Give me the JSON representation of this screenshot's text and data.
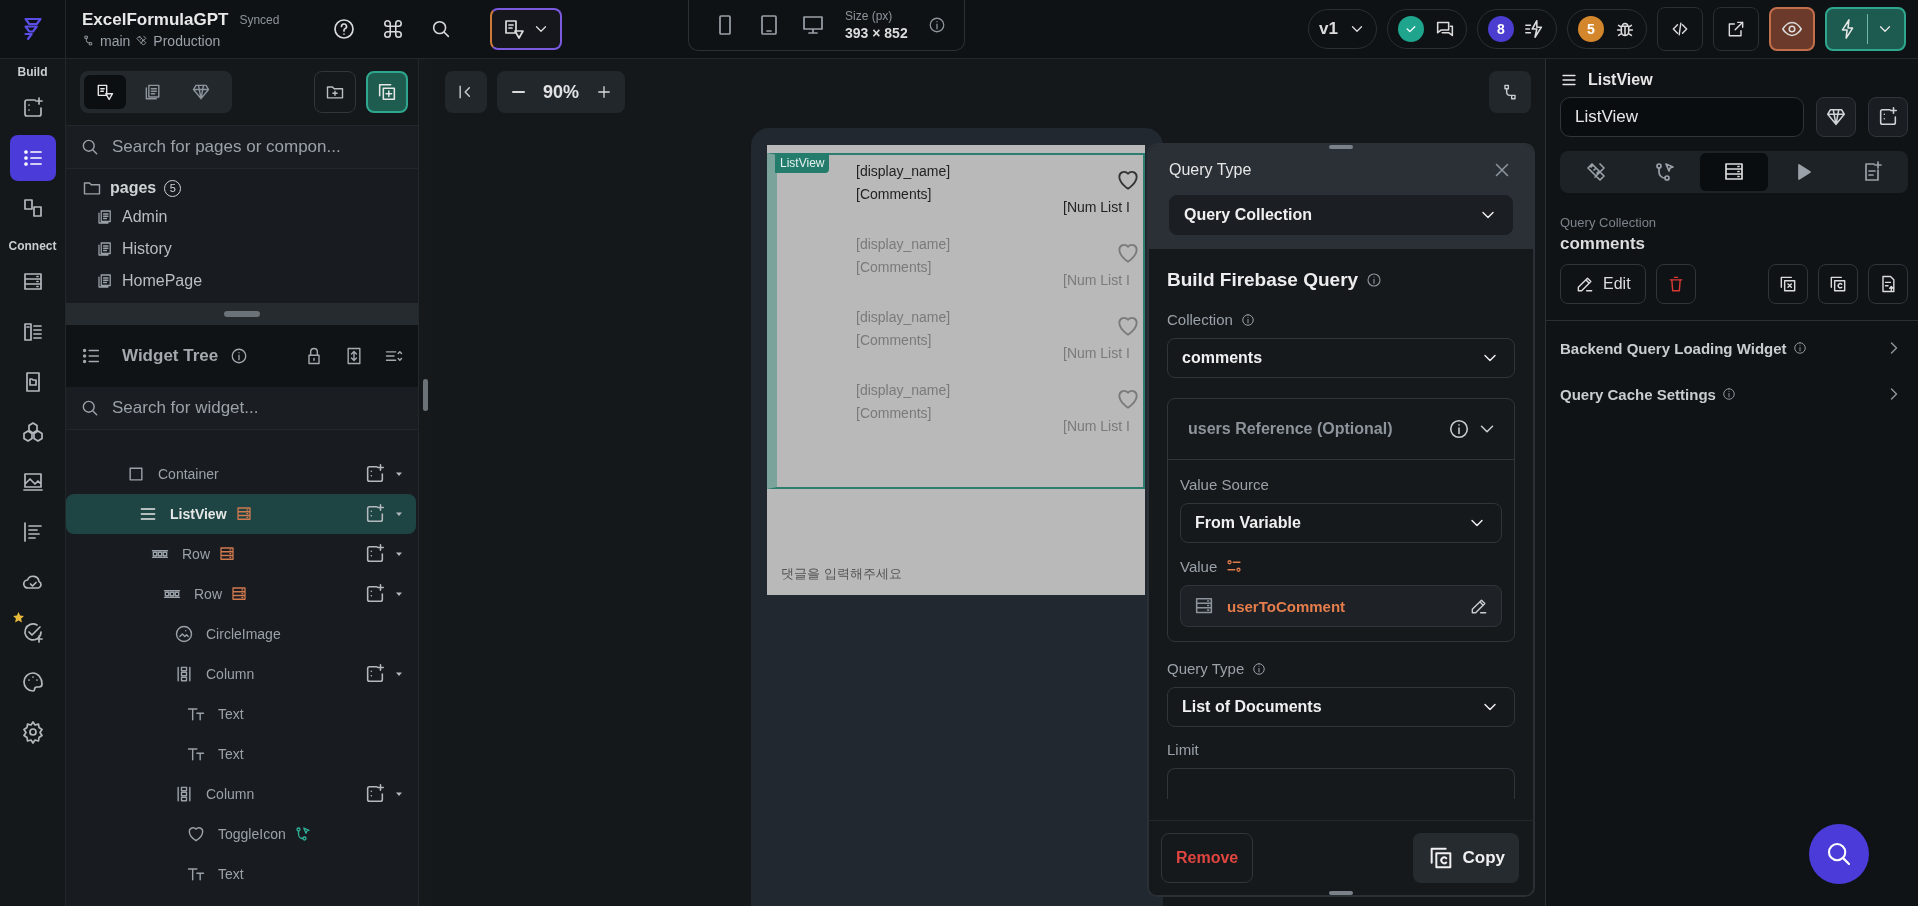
{
  "app": {
    "title": "ExcelFormulaGPT",
    "sync_status": "Synced",
    "branch": "main",
    "environment": "Production"
  },
  "device": {
    "devices": [
      {
        "kind": "phone"
      },
      {
        "kind": "tablet"
      },
      {
        "kind": "desktop"
      }
    ],
    "size_label": "Size (px)",
    "size": "393 × 852"
  },
  "toolbar": {
    "version": "v1",
    "actions_count": "8",
    "issues_count": "5"
  },
  "rail": {
    "sections": [
      {
        "title": "Build",
        "items": [
          {
            "kind": "add-widget",
            "selected": false
          },
          {
            "kind": "tree",
            "selected": true
          },
          {
            "kind": "storyboard",
            "selected": false
          }
        ]
      },
      {
        "title": "Connect",
        "items": [
          {
            "kind": "database",
            "selected": false
          },
          {
            "kind": "api",
            "selected": false
          },
          {
            "kind": "media",
            "selected": false
          },
          {
            "kind": "components",
            "selected": false
          },
          {
            "kind": "image",
            "selected": false
          },
          {
            "kind": "align",
            "selected": false
          },
          {
            "kind": "cloud",
            "selected": false
          },
          {
            "kind": "tests",
            "selected": false
          },
          {
            "kind": "palette",
            "selected": false
          },
          {
            "kind": "settings",
            "selected": false
          }
        ]
      }
    ]
  },
  "left_panel": {
    "tabs": [
      {
        "kind": "pages-theme",
        "selected": true
      },
      {
        "kind": "pages",
        "selected": false
      },
      {
        "kind": "gem",
        "selected": false
      }
    ],
    "search_placeholder": "Search for pages or compon..."
  },
  "pages": {
    "label": "pages",
    "count": "5",
    "items": [
      "Admin",
      "History",
      "HomePage"
    ]
  },
  "widget_tree": {
    "title": "Widget Tree",
    "search_placeholder": "Search for widget...",
    "nodes": [
      {
        "label": "Container",
        "kind": "container",
        "selected": false,
        "query": false,
        "action": false,
        "children": [
          {
            "label": "ListView",
            "kind": "listview",
            "selected": true,
            "query": true,
            "action": false,
            "children": [
              {
                "label": "Row",
                "kind": "row",
                "selected": false,
                "query": true,
                "action": false,
                "children": [
                  {
                    "label": "Row",
                    "kind": "row",
                    "selected": false,
                    "query": true,
                    "action": false,
                    "children": [
                      {
                        "label": "CircleImage",
                        "kind": "image",
                        "selected": false,
                        "query": false,
                        "action": false
                      },
                      {
                        "label": "Column",
                        "kind": "column",
                        "selected": false,
                        "query": false,
                        "action": false,
                        "children": [
                          {
                            "label": "Text",
                            "kind": "text",
                            "selected": false,
                            "query": false,
                            "action": false
                          },
                          {
                            "label": "Text",
                            "kind": "text",
                            "selected": false,
                            "query": false,
                            "action": false
                          }
                        ]
                      },
                      {
                        "label": "Column",
                        "kind": "column",
                        "selected": false,
                        "query": false,
                        "action": false,
                        "children": [
                          {
                            "label": "ToggleIcon",
                            "kind": "toggle",
                            "selected": false,
                            "query": false,
                            "action": true
                          },
                          {
                            "label": "Text",
                            "kind": "text",
                            "selected": false,
                            "query": false,
                            "action": false
                          }
                        ]
                      }
                    ]
                  }
                ]
              }
            ]
          }
        ]
      }
    ]
  },
  "canvas": {
    "zoom": "90%",
    "list_tag": "ListView",
    "items": [
      {
        "name": "[display_name]",
        "comment": "[Comments]",
        "count": "[Num List I",
        "dimmed": false
      },
      {
        "name": "[display_name]",
        "comment": "[Comments]",
        "count": "[Num List I",
        "dimmed": true
      },
      {
        "name": "[display_name]",
        "comment": "[Comments]",
        "count": "[Num List I",
        "dimmed": true
      },
      {
        "name": "[display_name]",
        "comment": "[Comments]",
        "count": "[Num List I",
        "dimmed": true
      }
    ],
    "input_placeholder": "댓글을 입력해주세요"
  },
  "query_panel": {
    "title": "Query Type",
    "query_type": "Query Collection",
    "section_title": "Build Firebase Query",
    "collection_label": "Collection",
    "collection": "comments",
    "reference": {
      "title": "users Reference (Optional)",
      "expanded": true,
      "value_source_label": "Value Source",
      "value_source": "From Variable",
      "value_label": "Value",
      "value": "userToComment"
    },
    "result_type_label": "Query Type",
    "result_type": "List of Documents",
    "limit_label": "Limit",
    "remove": "Remove",
    "copy": "Copy"
  },
  "properties": {
    "title": "ListView",
    "name_value": "ListView",
    "tabs": [
      {
        "kind": "properties",
        "selected": false
      },
      {
        "kind": "actions",
        "selected": false
      },
      {
        "kind": "backend-query",
        "selected": true
      },
      {
        "kind": "preview",
        "selected": false
      },
      {
        "kind": "document",
        "selected": false
      }
    ],
    "query_label": "Query Collection",
    "query_collection": "comments",
    "edit": "Edit",
    "sections": [
      "Backend Query Loading Widget",
      "Query Cache Settings"
    ]
  }
}
